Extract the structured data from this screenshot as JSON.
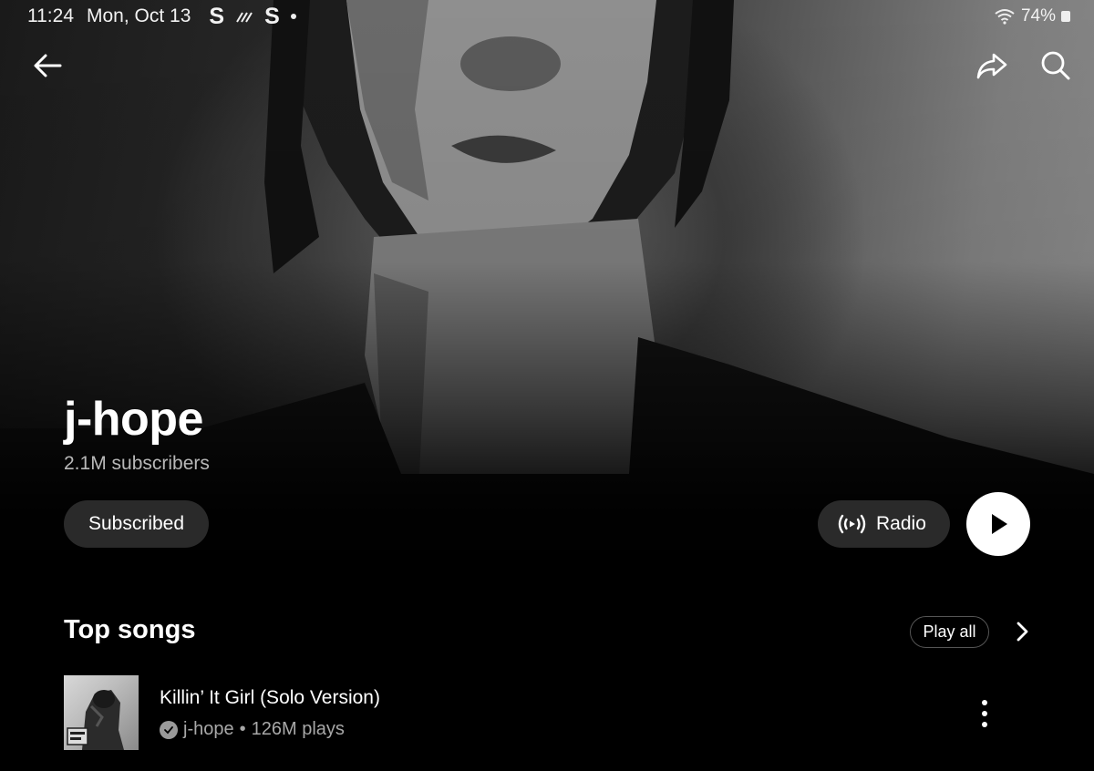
{
  "status_bar": {
    "time": "11:24",
    "date": "Mon, Oct 13",
    "app_glyph_1": "S",
    "app_glyph_2": "S",
    "battery": "74%"
  },
  "nav": {
    "back_icon": "arrow-left-icon",
    "share_icon": "share-icon",
    "search_icon": "search-icon"
  },
  "artist": {
    "name": "j-hope",
    "subscribers": "2.1M subscribers"
  },
  "actions": {
    "subscribe_label": "Subscribed",
    "radio_label": "Radio",
    "play_icon": "play-icon"
  },
  "top_songs": {
    "title": "Top songs",
    "play_all_label": "Play all",
    "songs": [
      {
        "title": "Killin’ It Girl (Solo Version)",
        "artist": "j-hope",
        "separator": "•",
        "plays": "126M plays"
      }
    ]
  },
  "colors": {
    "background": "#000000",
    "pill_bg": "#2a2a2a",
    "muted_text": "#a8a8a8",
    "play_button": "#ffffff"
  }
}
